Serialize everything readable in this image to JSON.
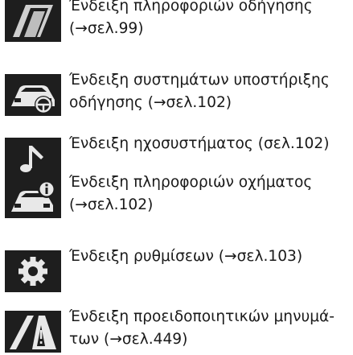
{
  "items": [
    {
      "icon": "driving-info-icon",
      "lines": [
        "Ένδειξη πληροφοριών οδήγησης",
        "(→σελ.99)"
      ]
    },
    {
      "icon": "driving-assist-icon",
      "lines": [
        "Ένδειξη συστημάτων υποστήριξης",
        "οδήγησης (→σελ.102)"
      ]
    },
    {
      "icon": "audio-note-icon",
      "lines": [
        "Ένδειξη ηχοσυστήματος (σελ.102)"
      ]
    },
    {
      "icon": "vehicle-info-icon",
      "lines": [
        "Ένδειξη πληροφοριών οχήματος",
        "(→σελ.102)"
      ]
    },
    {
      "icon": "settings-gear-icon",
      "lines": [
        "Ένδειξη ρυθμίσεων (→σελ.103)"
      ]
    },
    {
      "icon": "warning-triangle-icon",
      "lines": [
        "Ένδειξη προειδοποιητικών μηνυμά-",
        "των (→σελ.449)"
      ]
    }
  ]
}
